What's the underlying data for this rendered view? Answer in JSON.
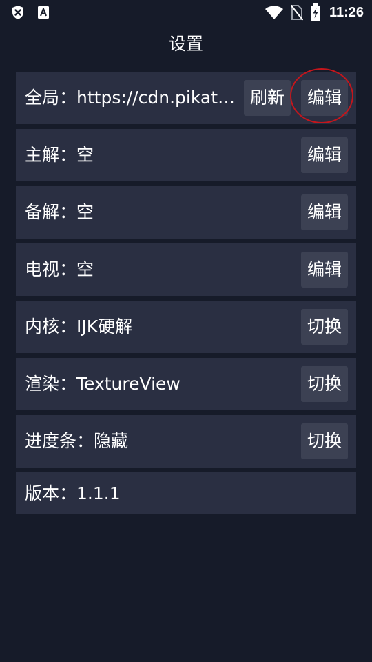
{
  "status_bar": {
    "icons_left": [
      "shield-x-icon",
      "a-notification-icon"
    ],
    "icons_right": [
      "wifi-icon",
      "no-sim-icon",
      "battery-charging-icon"
    ],
    "time": "11:26"
  },
  "header": {
    "title": "设置"
  },
  "settings": [
    {
      "label": "全局：https://cdn.pikat…",
      "buttons": [
        "刷新",
        "编辑"
      ]
    },
    {
      "label": "主解：空",
      "buttons": [
        "编辑"
      ]
    },
    {
      "label": "备解：空",
      "buttons": [
        "编辑"
      ]
    },
    {
      "label": "电视：空",
      "buttons": [
        "编辑"
      ]
    },
    {
      "label": "内核：IJK硬解",
      "buttons": [
        "切换"
      ]
    },
    {
      "label": "渲染：TextureView",
      "buttons": [
        "切换"
      ]
    },
    {
      "label": "进度条：隐藏",
      "buttons": [
        "切换"
      ]
    },
    {
      "label": "版本：1.1.1",
      "buttons": []
    }
  ],
  "colors": {
    "background": "#161b29",
    "row": "#2a2f42",
    "button": "#3c4153",
    "highlight": "#c4161c"
  }
}
